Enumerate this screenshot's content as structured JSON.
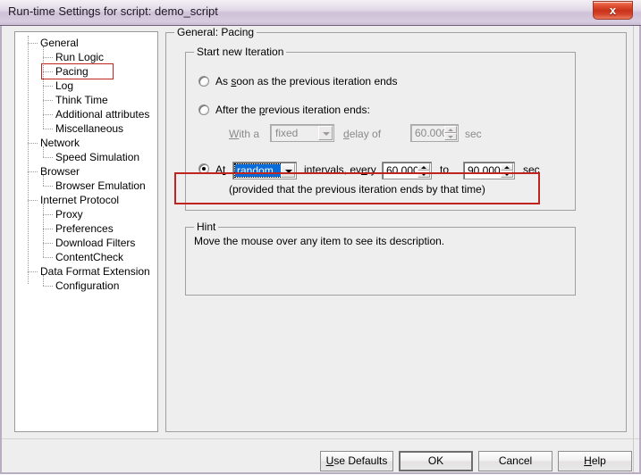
{
  "window": {
    "title": "Run-time Settings for script: demo_script",
    "close_label": "x"
  },
  "colors": {
    "highlight_red": "#c0241e",
    "selection_blue": "#0a6cd8",
    "titlebar": "#cfc2d9",
    "face": "#efeeee"
  },
  "tree": {
    "items": [
      {
        "label": "General",
        "level": 1
      },
      {
        "label": "Run Logic",
        "level": 2
      },
      {
        "label": "Pacing",
        "level": 2,
        "selected": true
      },
      {
        "label": "Log",
        "level": 2
      },
      {
        "label": "Think Time",
        "level": 2
      },
      {
        "label": "Additional attributes",
        "level": 2
      },
      {
        "label": "Miscellaneous",
        "level": 2
      },
      {
        "label": "Network",
        "level": 1
      },
      {
        "label": "Speed Simulation",
        "level": 2
      },
      {
        "label": "Browser",
        "level": 1
      },
      {
        "label": "Browser Emulation",
        "level": 2
      },
      {
        "label": "Internet Protocol",
        "level": 1
      },
      {
        "label": "Proxy",
        "level": 2
      },
      {
        "label": "Preferences",
        "level": 2
      },
      {
        "label": "Download Filters",
        "level": 2
      },
      {
        "label": "ContentCheck",
        "level": 2
      },
      {
        "label": "Data Format Extension",
        "level": 1
      },
      {
        "label": "Configuration",
        "level": 2
      }
    ]
  },
  "panel": {
    "title": "General: Pacing",
    "start_iteration": {
      "title": "Start new Iteration",
      "option_asap": {
        "label_pre": "As ",
        "label_accel": "s",
        "label_post": "oon as the previous iteration ends",
        "checked": false
      },
      "option_after": {
        "label_pre": "After the ",
        "label_accel": "p",
        "label_post": "revious iteration ends:",
        "checked": false
      },
      "delay_row": {
        "with_a_accel": "W",
        "with_a_rest": "ith a",
        "mode_value": "fixed",
        "delay_of_accel": "d",
        "delay_of_rest": "elay of",
        "delay_value": "60.000",
        "sec_label": "sec",
        "enabled": false
      },
      "option_at": {
        "label_pre": "A",
        "label_accel": "t",
        "checked": true,
        "mode_value": "random",
        "intervals_pre": "intervals, ev",
        "intervals_accel": "e",
        "intervals_post": "ry",
        "from_value": "60.000",
        "to_label": "to",
        "to_value": "90.000",
        "sec_label": "sec"
      },
      "note": "(provided that the previous iteration ends by that time)"
    },
    "hint": {
      "title": "Hint",
      "text": "Move the mouse over any item to see its description."
    }
  },
  "buttons": {
    "use_defaults_accel": "U",
    "use_defaults_rest": "se Defaults",
    "ok": "OK",
    "cancel": "Cancel",
    "help_accel": "H",
    "help_rest": "elp"
  }
}
